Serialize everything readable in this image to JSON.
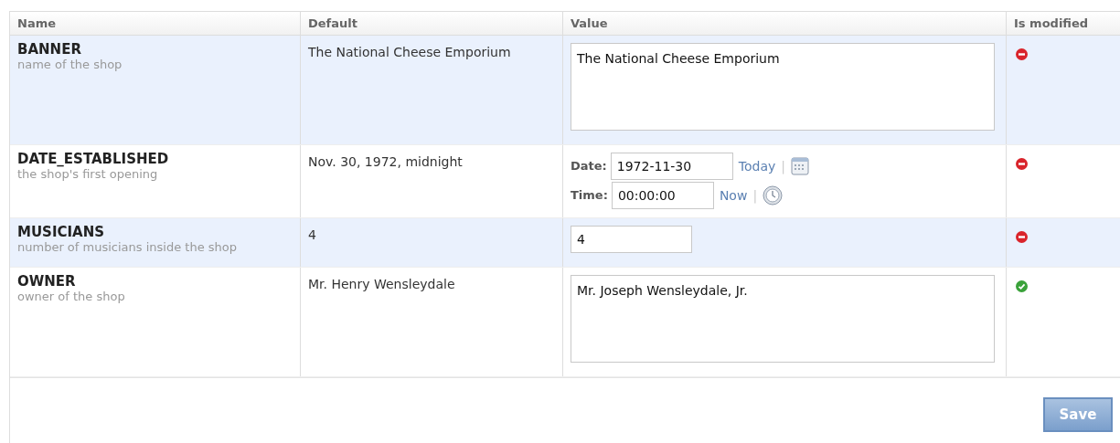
{
  "table": {
    "columns": [
      "Name",
      "Default",
      "Value",
      "Is modified"
    ],
    "rows": [
      {
        "name": "BANNER",
        "help": "name of the shop",
        "default": "The National Cheese Emporium",
        "kind": "textarea",
        "value": "The National Cheese Emporium",
        "modified": false
      },
      {
        "name": "DATE_ESTABLISHED",
        "help": "the shop's first opening",
        "default": "Nov. 30, 1972, midnight",
        "kind": "datetime",
        "date_label": "Date:",
        "date": "1972-11-30",
        "today": "Today",
        "separator_1": "|",
        "time_label": "Time:",
        "time": "00:00:00",
        "now": "Now",
        "separator_2": "|",
        "modified": false
      },
      {
        "name": "MUSICIANS",
        "help": "number of musicians inside the shop",
        "default": "4",
        "kind": "input",
        "value": "4",
        "modified": false
      },
      {
        "name": "OWNER",
        "help": "owner of the shop",
        "default": "Mr. Henry Wensleydale",
        "kind": "textarea",
        "value": "Mr. Joseph Wensleydale, Jr.",
        "modified": true
      }
    ]
  },
  "save_button": "Save"
}
